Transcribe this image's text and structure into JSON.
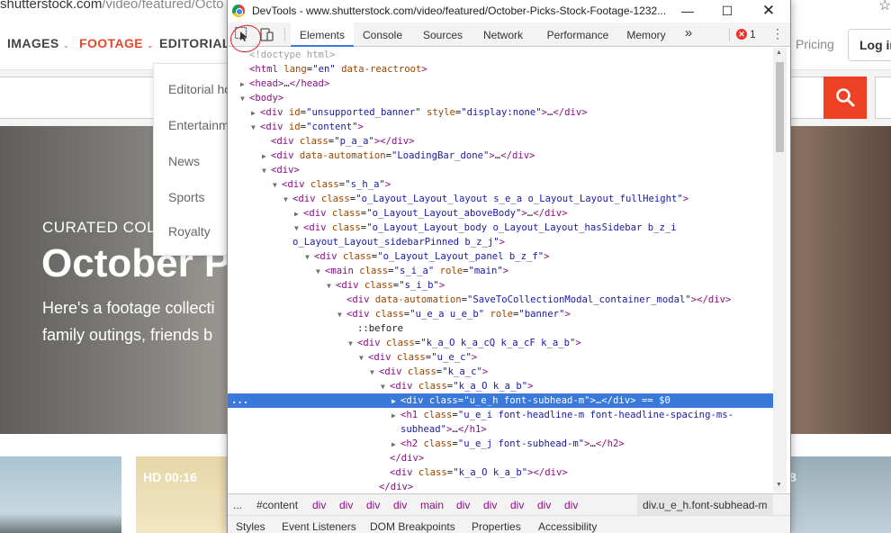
{
  "site": {
    "url_main": "shutterstock.com",
    "url_rest": "/video/featured/Octo",
    "nav": {
      "images": "IMAGES",
      "footage": "FOOTAGE",
      "editorial": "EDITORIAL",
      "pricing": "Pricing",
      "login": "Log in"
    },
    "editorial_menu": [
      "Editorial ho",
      "Entertainm",
      "News",
      "Sports",
      "Royalty"
    ],
    "hero": {
      "kicker": "CURATED COLLECTIONS",
      "title": "October P",
      "desc_line1": "Here's a footage collecti",
      "desc_line2": "family outings, friends b"
    },
    "thumbs": {
      "hd_label": "HD  00:16",
      "right_label": "8"
    }
  },
  "devtools": {
    "title": "DevTools - www.shutterstock.com/video/featured/October-Picks-Stock-Footage-1232...",
    "tabs": [
      "Elements",
      "Console",
      "Sources",
      "Network",
      "Performance",
      "Memory",
      "»"
    ],
    "active_tab": "Elements",
    "error_count": "1",
    "dom_lines": [
      {
        "indent": 0,
        "tri": "",
        "html": "<span class='cm'>&lt;!doctype html&gt;</span>"
      },
      {
        "indent": 0,
        "tri": "",
        "html": "<span class='tg'>&lt;html</span> <span class='an'>lang</span>=<span class='av'>\"en\"</span> <span class='an'>data-reactroot</span><span class='tg'>&gt;</span>"
      },
      {
        "indent": 0,
        "tri": "▶",
        "html": "<span class='tg'>&lt;head&gt;</span>…<span class='tg'>&lt;/head&gt;</span>"
      },
      {
        "indent": 0,
        "tri": "▼",
        "html": "<span class='tg'>&lt;body&gt;</span>"
      },
      {
        "indent": 1,
        "tri": "▶",
        "html": "<span class='tg'>&lt;div</span> <span class='an'>id</span>=<span class='av'>\"unsupported_banner\"</span> <span class='an'>style</span>=<span class='av'>\"display:none\"</span><span class='tg'>&gt;</span>…<span class='tg'>&lt;/div&gt;</span>"
      },
      {
        "indent": 1,
        "tri": "▼",
        "html": "<span class='tg'>&lt;div</span> <span class='an'>id</span>=<span class='av'>\"content\"</span><span class='tg'>&gt;</span>"
      },
      {
        "indent": 2,
        "tri": "",
        "html": "<span class='tg'>&lt;div</span> <span class='an'>class</span>=<span class='av'>\"p_a_a\"</span><span class='tg'>&gt;&lt;/div&gt;</span>"
      },
      {
        "indent": 2,
        "tri": "▶",
        "html": "<span class='tg'>&lt;div</span> <span class='an'>data-automation</span>=<span class='av'>\"LoadingBar_done\"</span><span class='tg'>&gt;</span>…<span class='tg'>&lt;/div&gt;</span>"
      },
      {
        "indent": 2,
        "tri": "▼",
        "html": "<span class='tg'>&lt;div&gt;</span>"
      },
      {
        "indent": 3,
        "tri": "▼",
        "html": "<span class='tg'>&lt;div</span> <span class='an'>class</span>=<span class='av'>\"s_h_a\"</span><span class='tg'>&gt;</span>"
      },
      {
        "indent": 4,
        "tri": "▼",
        "html": "<span class='tg'>&lt;div</span> <span class='an'>class</span>=<span class='av'>\"o_Layout_Layout_layout s_e_a o_Layout_Layout_fullHeight\"</span><span class='tg'>&gt;</span>"
      },
      {
        "indent": 5,
        "tri": "▶",
        "html": "<span class='tg'>&lt;div</span> <span class='an'>class</span>=<span class='av'>\"o_Layout_Layout_aboveBody\"</span><span class='tg'>&gt;</span>…<span class='tg'>&lt;/div&gt;</span>"
      },
      {
        "indent": 5,
        "tri": "▼",
        "html": "<span class='tg'>&lt;div</span> <span class='an'>class</span>=<span class='av'>\"o_Layout_Layout_body o_Layout_Layout_hasSidebar b_z_i</span>"
      },
      {
        "indent": 4,
        "tri": "",
        "html": "<span class='av'>o_Layout_Layout_sidebarPinned b_z_j\"</span><span class='tg'>&gt;</span>"
      },
      {
        "indent": 6,
        "tri": "▼",
        "html": "<span class='tg'>&lt;div</span> <span class='an'>class</span>=<span class='av'>\"o_Layout_Layout_panel b_z_f\"</span><span class='tg'>&gt;</span>"
      },
      {
        "indent": 7,
        "tri": "▼",
        "html": "<span class='tg'>&lt;main</span> <span class='an'>class</span>=<span class='av'>\"s_i_a\"</span> <span class='an'>role</span>=<span class='av'>\"main\"</span><span class='tg'>&gt;</span>"
      },
      {
        "indent": 8,
        "tri": "▼",
        "html": "<span class='tg'>&lt;div</span> <span class='an'>class</span>=<span class='av'>\"s_i_b\"</span><span class='tg'>&gt;</span>"
      },
      {
        "indent": 9,
        "tri": "",
        "html": "<span class='tg'>&lt;div</span> <span class='an'>data-automation</span>=<span class='av'>\"SaveToCollectionModal_container_modal\"</span><span class='tg'>&gt;&lt;/div&gt;</span>"
      },
      {
        "indent": 9,
        "tri": "▼",
        "html": "<span class='tg'>&lt;div</span> <span class='an'>class</span>=<span class='av'>\"u_e_a u_e_b\"</span> <span class='an'>role</span>=<span class='av'>\"banner\"</span><span class='tg'>&gt;</span>"
      },
      {
        "indent": 10,
        "tri": "",
        "html": "::before"
      },
      {
        "indent": 10,
        "tri": "▼",
        "html": "<span class='tg'>&lt;div</span> <span class='an'>class</span>=<span class='av'>\"k_a_O k_a_cQ k_a_cF k_a_b\"</span><span class='tg'>&gt;</span>"
      },
      {
        "indent": 11,
        "tri": "▼",
        "html": "<span class='tg'>&lt;div</span> <span class='an'>class</span>=<span class='av'>\"u_e_c\"</span><span class='tg'>&gt;</span>"
      },
      {
        "indent": 12,
        "tri": "▼",
        "html": "<span class='tg'>&lt;div</span> <span class='an'>class</span>=<span class='av'>\"k_a_c\"</span><span class='tg'>&gt;</span>"
      },
      {
        "indent": 13,
        "tri": "▼",
        "html": "<span class='tg'>&lt;div</span> <span class='an'>class</span>=<span class='av'>\"k_a_O k_a_b\"</span><span class='tg'>&gt;</span>"
      },
      {
        "indent": 14,
        "tri": "▶",
        "html": "<span class='tg'>&lt;div</span> <span class='an'>class</span>=<span class='av'>\"u_e_h font-subhead-m\"</span><span class='tg'>&gt;</span>…<span class='tg'>&lt;/div&gt;</span> == $0",
        "selected": true
      },
      {
        "indent": 14,
        "tri": "▶",
        "html": "<span class='tg'>&lt;h1</span> <span class='an'>class</span>=<span class='av'>\"u_e_i font-headline-m font-headline-spacing-ms-</span>"
      },
      {
        "indent": 14,
        "tri": "",
        "html": "<span class='av'>subhead\"</span><span class='tg'>&gt;</span>…<span class='tg'>&lt;/h1&gt;</span>"
      },
      {
        "indent": 14,
        "tri": "▶",
        "html": "<span class='tg'>&lt;h2</span> <span class='an'>class</span>=<span class='av'>\"u_e_j font-subhead-m\"</span><span class='tg'>&gt;</span>…<span class='tg'>&lt;/h2&gt;</span>"
      },
      {
        "indent": 13,
        "tri": "",
        "html": "<span class='tg'>&lt;/div&gt;</span>"
      },
      {
        "indent": 13,
        "tri": "",
        "html": "<span class='tg'>&lt;div</span> <span class='an'>class</span>=<span class='av'>\"k_a_O k_a_b\"</span><span class='tg'>&gt;&lt;/div&gt;</span>"
      },
      {
        "indent": 12,
        "tri": "",
        "html": "<span class='tg'>&lt;/div&gt;</span>"
      }
    ],
    "breadcrumbs": [
      "...",
      "#content",
      "div",
      "div",
      "div",
      "div",
      "main",
      "div",
      "div",
      "div",
      "div",
      "div",
      "div.u_e_h.font-subhead-m"
    ],
    "bottom_tabs": [
      "Styles",
      "Event Listeners",
      "DOM Breakpoints",
      "Properties",
      "Accessibility"
    ]
  }
}
